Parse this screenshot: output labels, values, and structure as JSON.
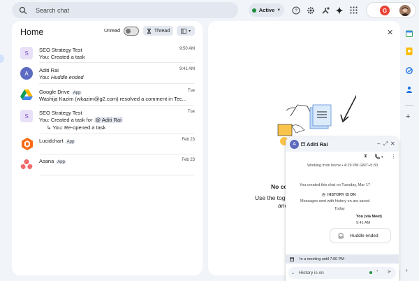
{
  "search": {
    "placeholder": "Search chat"
  },
  "status": {
    "label": "Active"
  },
  "home": {
    "title": "Home",
    "unread_label": "Unread",
    "thread_label": "Thread"
  },
  "conversations": [
    {
      "avatar_letter": "S",
      "avatar_color": "#e8e0f7",
      "avatar_text_color": "#7b4fc9",
      "name": "SEO Strategy Test",
      "sub": "You: Created a task",
      "time": "9:50 AM"
    },
    {
      "avatar_letter": "A",
      "avatar_color": "#5c6bc0",
      "avatar_text_color": "#ffffff",
      "name": "Aditi Rai",
      "sub_prefix": "You: ",
      "sub_italic": "Huddle ended",
      "time": "9:41 AM"
    },
    {
      "name": "Google Drive",
      "tag": "App",
      "sub": "Washija Kazim (wkazim@g2.com) resolved a comment in Tec...",
      "time": "Tue"
    },
    {
      "avatar_letter": "S",
      "avatar_color": "#e8e0f7",
      "avatar_text_color": "#7b4fc9",
      "name": "SEO Strategy Test",
      "sub_prefix": "You: Created a task for ",
      "mention": "@ Aditi Rai",
      "sub2": "You: Re-opened a task",
      "time": "Tue"
    },
    {
      "name": "Lucidchart",
      "tag": "App",
      "time": "Feb 23"
    },
    {
      "name": "Asana",
      "tag": "App",
      "time": "Feb 23"
    }
  ],
  "main": {
    "empty_title": "No co",
    "empty_line1": "Use the togg",
    "empty_line2": "anc"
  },
  "chat": {
    "name": "Aditi Rai",
    "avatar_letter": "A",
    "status_line": "Working from home • 4:29 PM GMT+5:30",
    "created_line": "You created this chat on Tuesday, Mar 17",
    "history_on": "HISTORY IS ON",
    "history_saved": "Messages sent with history on are saved",
    "today": "Today",
    "sender": "You (via Meet)",
    "sent_time": "9:41 AM",
    "huddle_ended": "Huddle ended",
    "meeting_status": "In a meeting until 7:00 PM",
    "compose_placeholder": "History is on"
  },
  "colors": {
    "accent": "#0b57d0",
    "active_green": "#1e8e3e"
  }
}
